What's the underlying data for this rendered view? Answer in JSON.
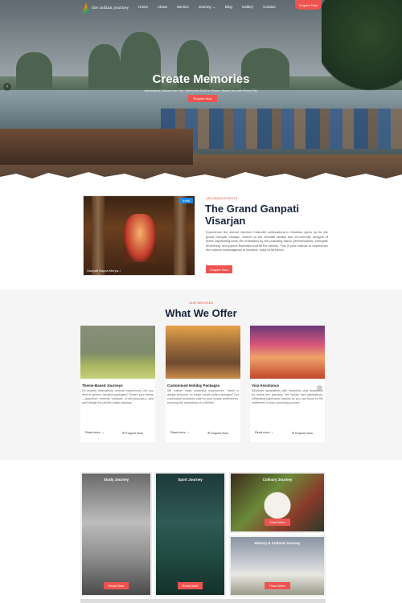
{
  "nav": {
    "logo_text": "the indian journey",
    "items": [
      "Home",
      "About",
      "Service",
      "Journey",
      "Blog",
      "Gallery",
      "Contact"
    ],
    "enquire_label": "Enquire Now"
  },
  "hero": {
    "title": "Create Memories",
    "subtitle": "Adventures Tailored for You, Memories Built to Share: Spark Joy with Every Trip",
    "button_label": "Enquire Now"
  },
  "event": {
    "tag": "India",
    "caption": "Ganpati Bappa Morya..!",
    "eyebrow": "UPCOMING EVENTS",
    "title": "The Grand Ganpati Visarjan",
    "description": "Experience the vibrant Ganesh Chaturthi celebrations in Mumbai, gives up for the grand Ganpati Visarjan. Marvel at the intricate details and eco-friendly designs of these captivating idols. Be enthralled by the pulsating dance performances, energetic drumming, and joyous festivities that fill the streets. This is your chance to experience the cultural extravaganza of Mumbai, India at its finest!",
    "button_label": "Enquire Now"
  },
  "services": {
    "eyebrow": "OUR SERVICES",
    "title": "What We Offer",
    "cards": [
      {
        "title": "Theme-Based Journeys",
        "description": "Go beyond destinations; choose experiences. Are you tired of generic vacation packages? Dream your theme—adventure, serenity, romance, or self-discovery—and we'll design the perfect Indian odyssey.",
        "read_more": "Read more →",
        "enquire": "Enquire Now"
      },
      {
        "title": "Customised Holiday Packages",
        "description": "We custom make dreamlike experiences. Travel is deeply personal, so forget cookie-cutter packages! Our customized itineraries cater to your unique preferences, ensuring the experience of a lifetime.",
        "read_more": "Read more →",
        "enquire": "Enquire Now"
      },
      {
        "title": "Visa Assistance",
        "description": "Effortless applications with seamless visa assistance for stress-free planning. We handle visa applications, eliminating paperwork hassles so you can focus on the excitement of your upcoming journey!",
        "read_more": "Read more →",
        "enquire": "Enquire Now"
      }
    ]
  },
  "journeys": [
    {
      "title": "Study Journey",
      "button": "Read More"
    },
    {
      "title": "Sport Journey",
      "button": "Read More"
    },
    {
      "title": "Culinary Journey",
      "button": "Read More"
    },
    {
      "title": "History & Cultural Journey",
      "button": "Read More"
    }
  ],
  "colors": {
    "accent": "#ef5350",
    "heading": "#17233b",
    "eyebrow": "#e74c3c"
  }
}
